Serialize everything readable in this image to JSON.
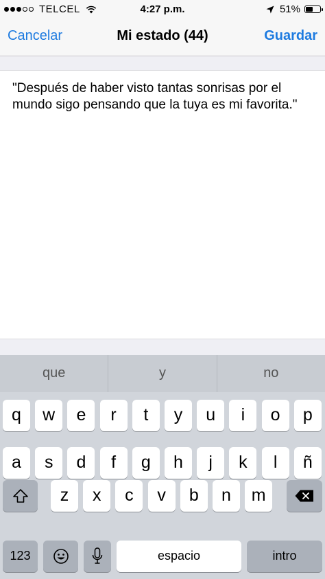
{
  "status_bar": {
    "signal_bars": 3,
    "signal_total": 5,
    "carrier": "TELCEL",
    "time": "4:27 p.m.",
    "battery_percent": "51%",
    "battery_level": 0.51
  },
  "nav": {
    "cancel_label": "Cancelar",
    "title": "Mi estado (44)",
    "save_label": "Guardar"
  },
  "status_text": "\"Después de haber visto tantas sonrisas por el mundo sigo pensando que la tuya es mi favorita.\"",
  "keyboard": {
    "suggestions": [
      "que",
      "y",
      "no"
    ],
    "row1": [
      "q",
      "w",
      "e",
      "r",
      "t",
      "y",
      "u",
      "i",
      "o",
      "p"
    ],
    "row2": [
      "a",
      "s",
      "d",
      "f",
      "g",
      "h",
      "j",
      "k",
      "l",
      "ñ"
    ],
    "row3": [
      "z",
      "x",
      "c",
      "v",
      "b",
      "n",
      "m"
    ],
    "numbers_label": "123",
    "space_label": "espacio",
    "return_label": "intro"
  },
  "icons": {
    "wifi": "wifi-icon",
    "location": "location-arrow-icon",
    "shift": "shift-icon",
    "backspace": "backspace-icon",
    "emoji": "emoji-icon",
    "microphone": "microphone-icon"
  },
  "colors": {
    "accent": "#1e7be0",
    "keyboard_bg": "#d1d5db",
    "special_key": "#abb1ba"
  }
}
